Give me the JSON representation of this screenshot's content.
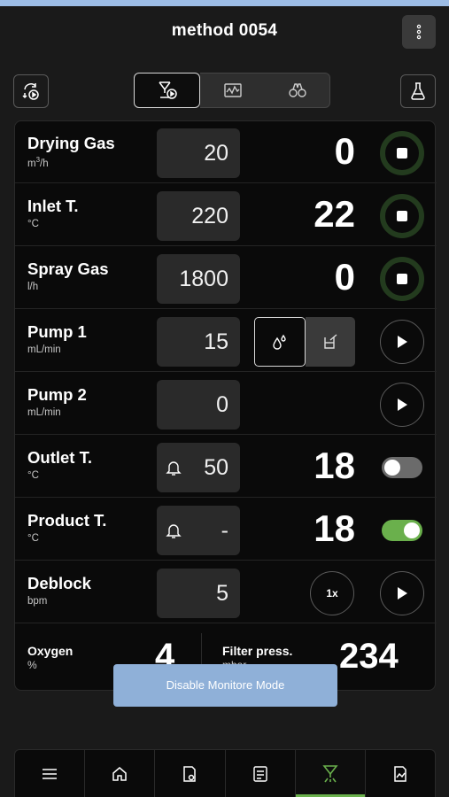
{
  "header": {
    "title": "method 0054",
    "menu_icon": "kebab-menu-icon"
  },
  "toolbar": {
    "left_icon": "sync-run-icon",
    "right_icon": "flask-icon",
    "tabs": [
      {
        "icon": "spray-run-icon",
        "active": true
      },
      {
        "icon": "chart-icon",
        "active": false
      },
      {
        "icon": "binoculars-icon",
        "active": false
      }
    ]
  },
  "rows": {
    "drying_gas": {
      "name": "Drying Gas",
      "unit_base": "m",
      "unit_sup": "3",
      "unit_tail": "/h",
      "setpoint": "20",
      "value": "0"
    },
    "inlet_t": {
      "name": "Inlet T.",
      "unit": "°C",
      "setpoint": "220",
      "value": "22"
    },
    "spray_gas": {
      "name": "Spray Gas",
      "unit": "l/h",
      "setpoint": "1800",
      "value": "0"
    },
    "pump1": {
      "name": "Pump 1",
      "unit": "mL/min",
      "setpoint": "15",
      "mode_icons": [
        "drops-icon",
        "beaker-icon"
      ]
    },
    "pump2": {
      "name": "Pump 2",
      "unit": "mL/min",
      "setpoint": "0"
    },
    "outlet_t": {
      "name": "Outlet T.",
      "unit": "°C",
      "setpoint": "50",
      "value": "18",
      "alarm_enabled": false
    },
    "product_t": {
      "name": "Product T.",
      "unit": "°C",
      "setpoint": "-",
      "value": "18",
      "alarm_enabled": true
    },
    "deblock": {
      "name": "Deblock",
      "unit": "bpm",
      "setpoint": "5",
      "multiplier": "1x"
    }
  },
  "readouts": {
    "oxygen": {
      "name": "Oxygen",
      "unit": "%",
      "value": "4"
    },
    "filter_press": {
      "name": "Filter press.",
      "unit": "mbar",
      "value": "234"
    }
  },
  "toast": {
    "label": "Disable Monitore Mode"
  },
  "colors": {
    "accent_green": "#6ab04c",
    "ring_green": "#233b1e",
    "toast_blue": "#8fb0d8"
  },
  "bottom_nav": [
    "menu-icon",
    "home-icon",
    "device-icon",
    "checklist-icon",
    "spray-icon",
    "report-icon"
  ]
}
